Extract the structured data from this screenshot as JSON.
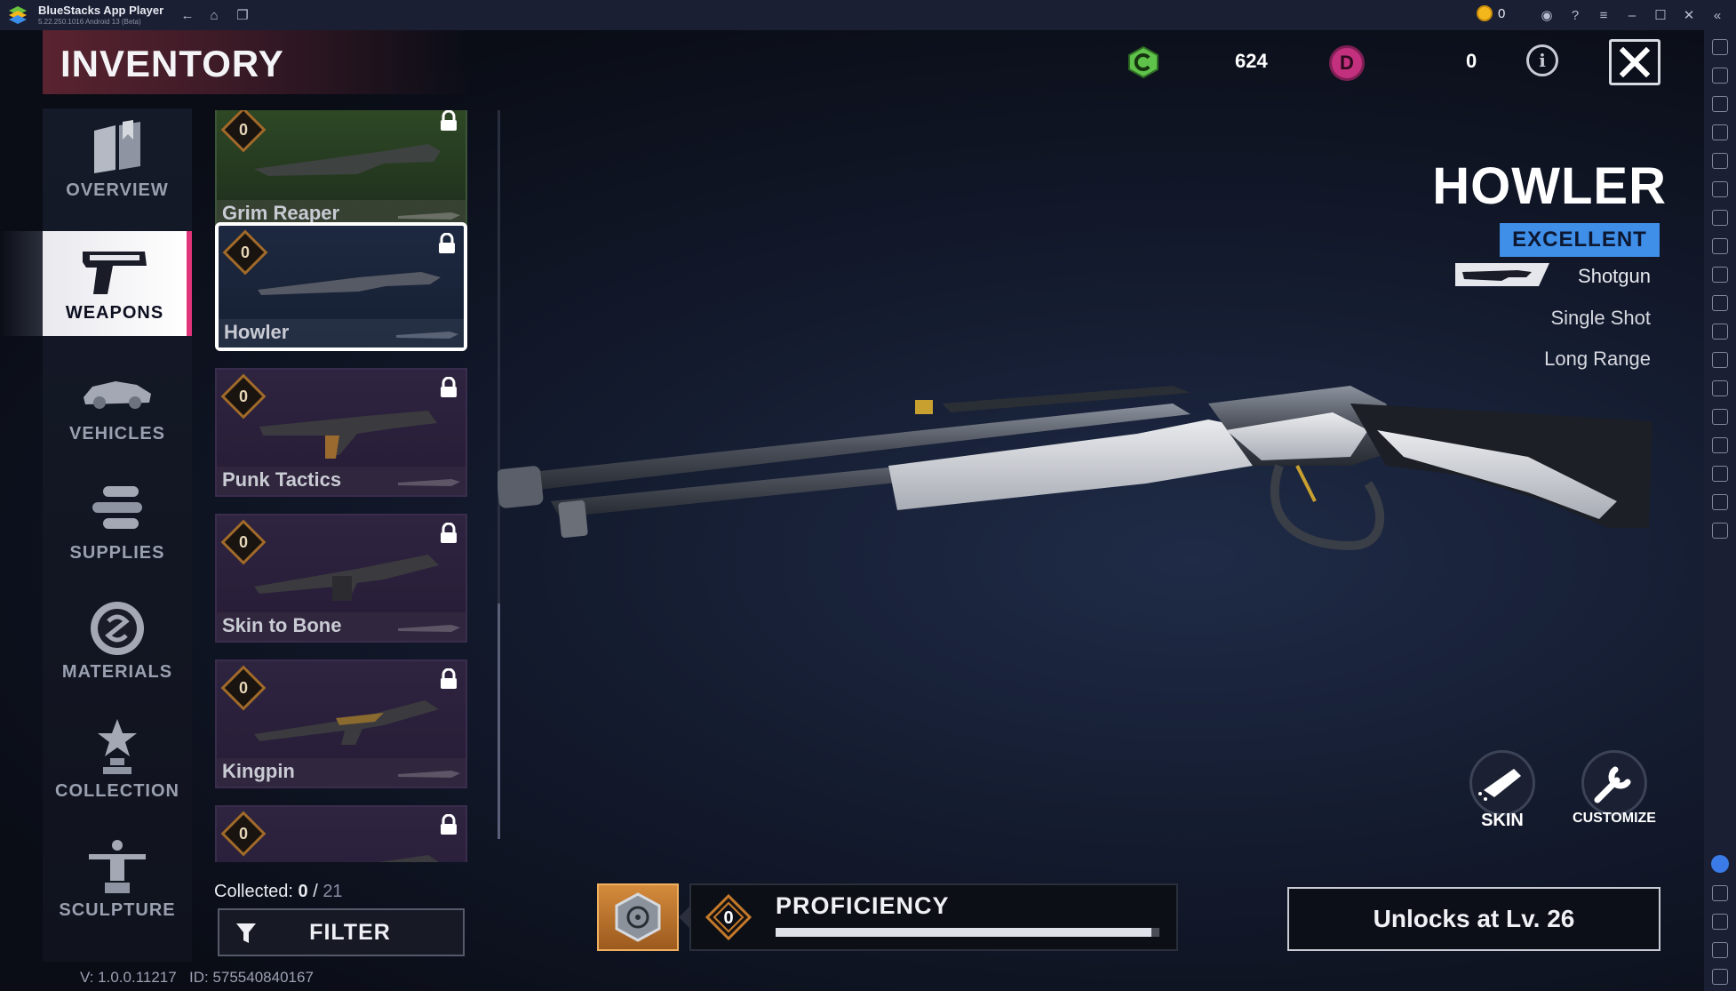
{
  "window": {
    "title": "BlueStacks App Player",
    "version": "5.22.250.1016  Android 13 (Beta)",
    "coins": "0"
  },
  "header": {
    "title": "INVENTORY",
    "currency_green_value": "624",
    "currency_pink_letter": "D",
    "currency_pink_value": "0",
    "info_icon": "i"
  },
  "nav": {
    "items": [
      {
        "label": "OVERVIEW",
        "icon": "book-icon",
        "active": false
      },
      {
        "label": "WEAPONS",
        "icon": "pistol-icon",
        "active": true
      },
      {
        "label": "VEHICLES",
        "icon": "car-icon",
        "active": false
      },
      {
        "label": "SUPPLIES",
        "icon": "ammo-icon",
        "active": false
      },
      {
        "label": "MATERIALS",
        "icon": "coin-icon",
        "active": false
      },
      {
        "label": "COLLECTION",
        "icon": "trophy-icon",
        "active": false
      },
      {
        "label": "SCULPTURE",
        "icon": "statue-icon",
        "active": false
      }
    ]
  },
  "weapons_list": [
    {
      "name": "Grim Reaper",
      "level": "0",
      "locked": true,
      "color": "green"
    },
    {
      "name": "Howler",
      "level": "0",
      "locked": true,
      "color": "blue",
      "selected": true
    },
    {
      "name": "Punk Tactics",
      "level": "0",
      "locked": true,
      "color": "purple"
    },
    {
      "name": "Skin to Bone",
      "level": "0",
      "locked": true,
      "color": "purple"
    },
    {
      "name": "Kingpin",
      "level": "0",
      "locked": true,
      "color": "purple"
    },
    {
      "name": "",
      "level": "0",
      "locked": true,
      "color": "purple"
    }
  ],
  "collected": {
    "label": "Collected:",
    "count": "0",
    "separator": "/",
    "total": "21"
  },
  "filter": {
    "label": "FILTER"
  },
  "footer": {
    "version": "V: 1.0.0.11217",
    "id": "ID: 575540840167"
  },
  "weapon": {
    "name": "HOWLER",
    "rarity": "EXCELLENT",
    "rarity_color": "#3f8ee8",
    "type": "Shotgun",
    "fire_mode": "Single Shot",
    "range": "Long Range"
  },
  "actions": {
    "skin_label": "SKIN",
    "customize_label": "CUSTOMIZE"
  },
  "proficiency": {
    "label": "PROFICIENCY",
    "level": "0",
    "progress": 0.98
  },
  "unlock": {
    "label": "Unlocks at Lv. 26"
  },
  "colors": {
    "accent_pink": "#e0357a",
    "green_currency": "#5fc24a",
    "pink_currency": "#c2307e"
  }
}
